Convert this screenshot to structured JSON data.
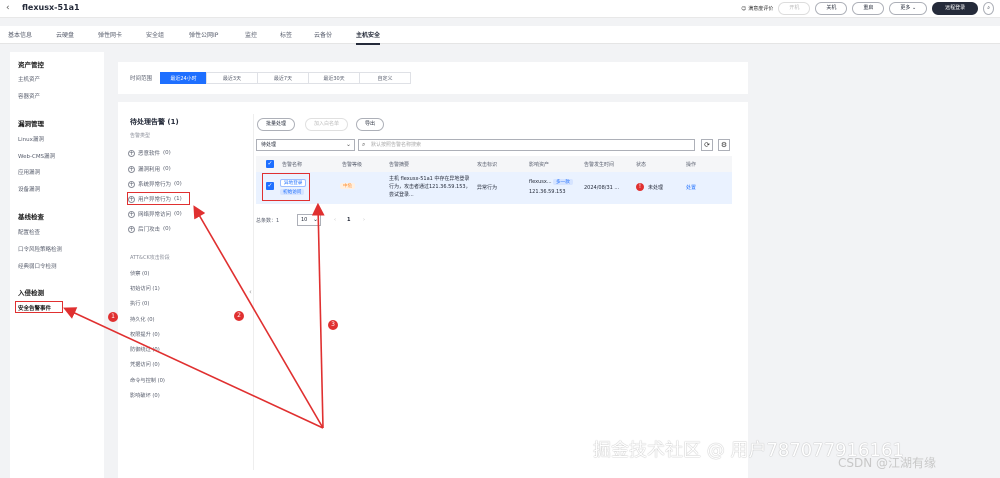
{
  "header": {
    "back_icon": "chevron-left-icon",
    "title": "flexusx-51a1",
    "feedback_label": "满意度评价",
    "btn_start": "开机",
    "btn_shutdown": "关机",
    "btn_restart": "重启",
    "btn_more": "更多",
    "btn_remote": "远程登录"
  },
  "tabs": [
    "基本信息",
    "云硬盘",
    "弹性网卡",
    "安全组",
    "弹性公网IP",
    "监控",
    "标签",
    "云备份",
    "主机安全"
  ],
  "sidebar": {
    "group1": "资产管控",
    "group1_items": [
      "主机资产",
      "容器资产"
    ],
    "group2": "漏洞管理",
    "group2_items": [
      "Linux漏洞",
      "Web-CMS漏洞",
      "应用漏洞",
      "设备漏洞"
    ],
    "group3": "基线检查",
    "group3_items": [
      "配置检查",
      "口令风险策略检测",
      "经典弱口令检测"
    ],
    "group4": "入侵检测",
    "group4_items": [
      "安全告警事件"
    ]
  },
  "filter": {
    "label": "时间范围",
    "options": [
      "最近24小时",
      "最近3天",
      "最近7天",
      "最近30天",
      "自定义"
    ]
  },
  "left_panel": {
    "title": "待处理告警 (1)",
    "subtitle": "告警类型",
    "categories": [
      {
        "name": "恶意软件",
        "count": "(0)"
      },
      {
        "name": "漏洞利用",
        "count": "(0)"
      },
      {
        "name": "系统异常行为",
        "count": "(0)"
      },
      {
        "name": "用户异常行为",
        "count": "(1)"
      },
      {
        "name": "网络异常访问",
        "count": "(0)"
      },
      {
        "name": "后门攻击",
        "count": "(0)"
      }
    ],
    "attck_title": "ATT&CK攻击阶段",
    "attck": [
      "侦察 (0)",
      "初始访问 (1)",
      "执行 (0)",
      "持久化 (0)",
      "权限提升 (0)",
      "防御绕过 (0)",
      "凭据访问 (0)",
      "命令与控制 (0)",
      "影响破坏 (0)"
    ]
  },
  "actions": {
    "batch": "批量处理",
    "whitelist": "加入白名单",
    "export": "导出"
  },
  "table": {
    "status_filter": "待处理",
    "search_placeholder": "默认按照告警名称搜索",
    "headers": [
      "告警名称",
      "告警等级",
      "告警摘要",
      "攻击标识",
      "影响资产",
      "告警发生时间",
      "状态",
      "操作"
    ],
    "rows": [
      {
        "name": "异地登录",
        "tag": "初始访问",
        "level": "中危",
        "summary": "主机 flexusx-51a1 中存在异地登录行为，攻击者通过121.36.59.153，尝试登录...",
        "attack": "异常行为",
        "asset_name": "flexusx...",
        "asset_badge": "多一款",
        "asset_ip": "121.36.59.153",
        "time": "2024/08/31 ...",
        "status": "未处理",
        "operation": "处置"
      }
    ]
  },
  "pager": {
    "total_label": "总条数：1",
    "page_size": "10",
    "current": "1"
  },
  "markers": [
    "1",
    "2",
    "3"
  ],
  "watermark": "掘金技术社区 @ 用户787077916161",
  "watermark2": "CSDN @江湖有缘",
  "colors": {
    "primary": "#1e6fff",
    "annotation_red": "#e03030",
    "warning_orange": "#ff8c2a"
  }
}
